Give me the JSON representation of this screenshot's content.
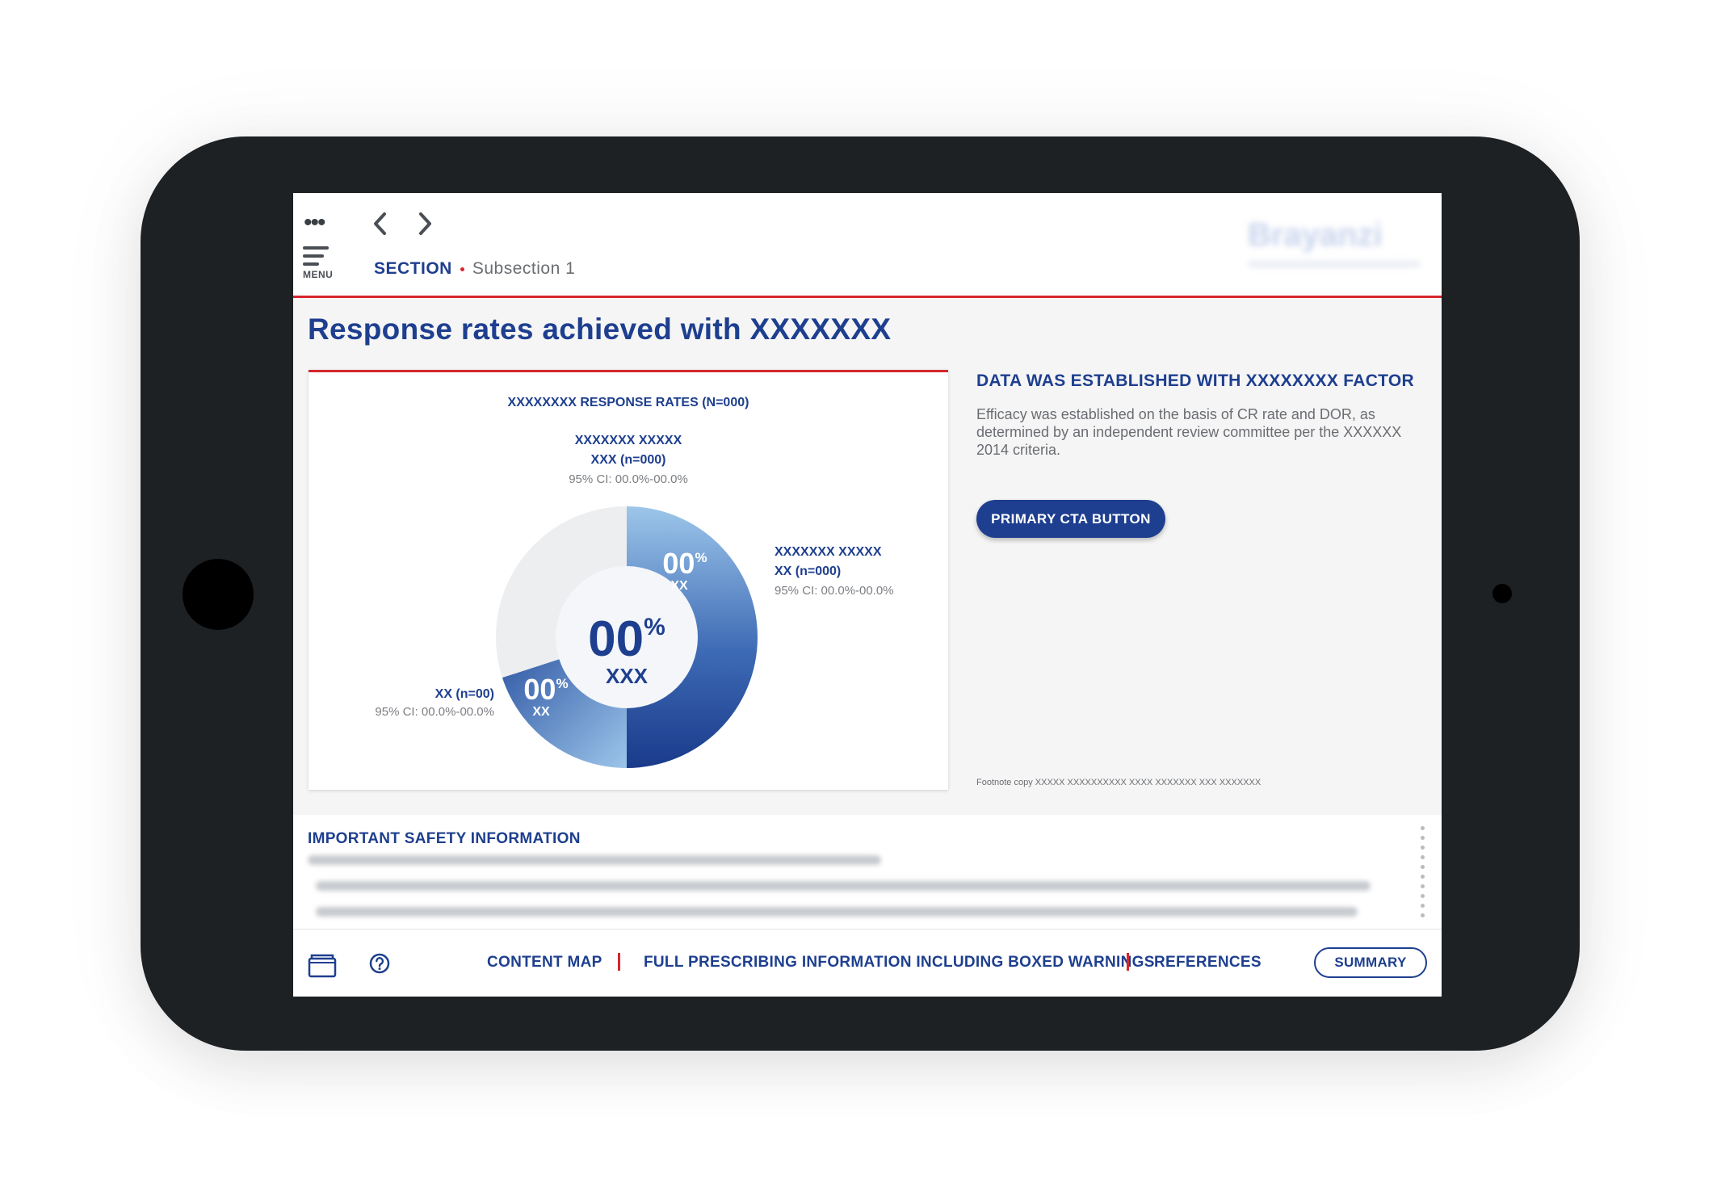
{
  "header": {
    "more_label": "•••",
    "menu_label": "MENU",
    "section": "SECTION",
    "subsection": "Subsection 1"
  },
  "page": {
    "title": "Response rates achieved with XXXXXXX"
  },
  "chart": {
    "title": "XXXXXXXX RESPONSE RATES (N=000)",
    "top_label": {
      "line1": "XXXXXXX XXXXX",
      "line2": "XXX (n=000)",
      "line3": "95% CI: 00.0%-00.0%"
    },
    "right_label": {
      "line1": "XXXXXXX XXXXX",
      "line2": "XX (n=000)",
      "line3": "95% CI: 00.0%-00.0%"
    },
    "left_label": {
      "line1": "XX (n=00)",
      "line2": "95% CI: 00.0%-00.0%"
    },
    "center_value": "00",
    "center_sup": "%",
    "center_label": "XXX",
    "right_seg_value": "00",
    "right_seg_sup": "%",
    "right_seg_label": "XX",
    "left_seg_value": "00",
    "left_seg_sup": "%",
    "left_seg_label": "XX"
  },
  "chart_data": {
    "type": "pie",
    "title": "XXXXXXXX RESPONSE RATES (N=000)",
    "categories": [
      "XXXXXXX XXXXX XX (n=000)",
      "XX (n=00)",
      ""
    ],
    "values": [
      0.5,
      0.2,
      0.3
    ],
    "colors": [
      "#1e3f8f",
      "#2f5aa8",
      "#edeeef"
    ],
    "center_text": "00% XXX"
  },
  "side": {
    "heading": "DATA WAS ESTABLISHED WITH XXXXXXXX FACTOR",
    "body": "Efficacy was established on the basis of CR rate and DOR, as determined by an independent review committee per the XXXXXX 2014 criteria.",
    "cta_label": "PRIMARY CTA BUTTON",
    "footnote": "Footnote copy XXXXX XXXXXXXXXX XXXX XXXXXXX XXX XXXXXXX"
  },
  "isi": {
    "title": "IMPORTANT SAFETY INFORMATION"
  },
  "bottom": {
    "content_map": "CONTENT MAP",
    "full_pi": "FULL PRESCRIBING INFORMATION INCLUDING BOXED WARNINGS",
    "references": "REFERENCES",
    "summary": "SUMMARY"
  },
  "colors": {
    "brand_blue": "#1e3f8f",
    "accent_red": "#d6262e",
    "text_gray": "#6a6d72",
    "device": "#1d2124"
  },
  "icons": [
    "more-icon",
    "chevron-left-icon",
    "chevron-right-icon",
    "menu-icon",
    "folder-icon",
    "help-icon"
  ]
}
